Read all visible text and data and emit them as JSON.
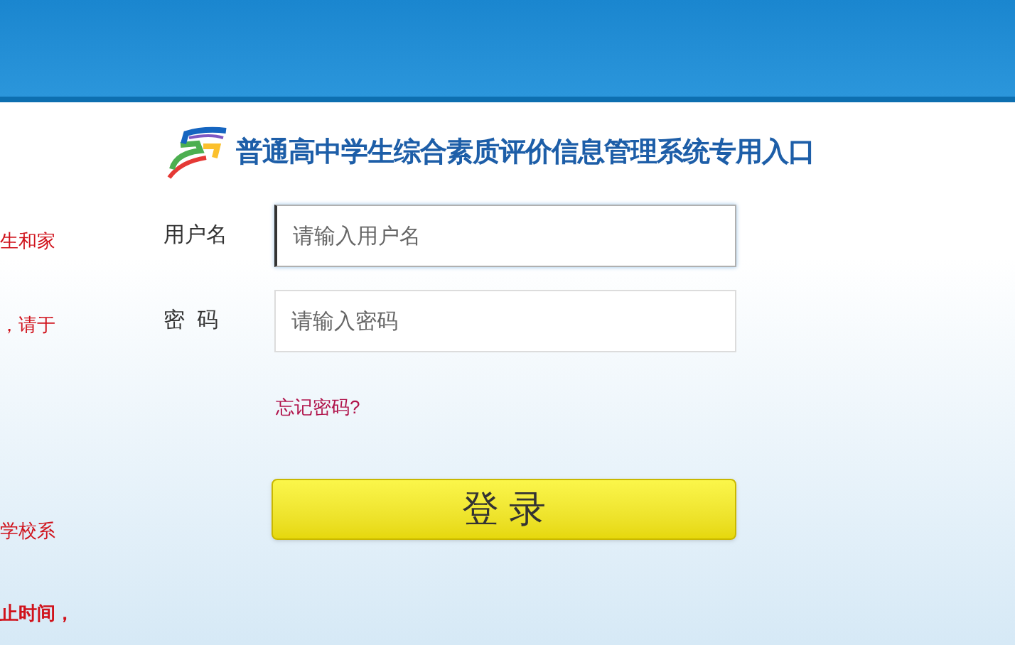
{
  "notice_fragments": [
    {
      "text": "生和家",
      "bold": false
    },
    {
      "text": "，请于",
      "bold": false
    },
    {
      "text": "学校系",
      "bold": false
    },
    {
      "text": "止时间，",
      "bold": true
    }
  ],
  "title": "普通高中学生综合素质评价信息管理系统专用入口",
  "form": {
    "fields": [
      {
        "label": "用户名",
        "placeholder": "请输入用户名",
        "focused": true
      },
      {
        "label": "密  码",
        "placeholder": "请输入密码",
        "focused": false
      }
    ],
    "forgot_link": "忘记密码?",
    "submit": "登 录"
  }
}
